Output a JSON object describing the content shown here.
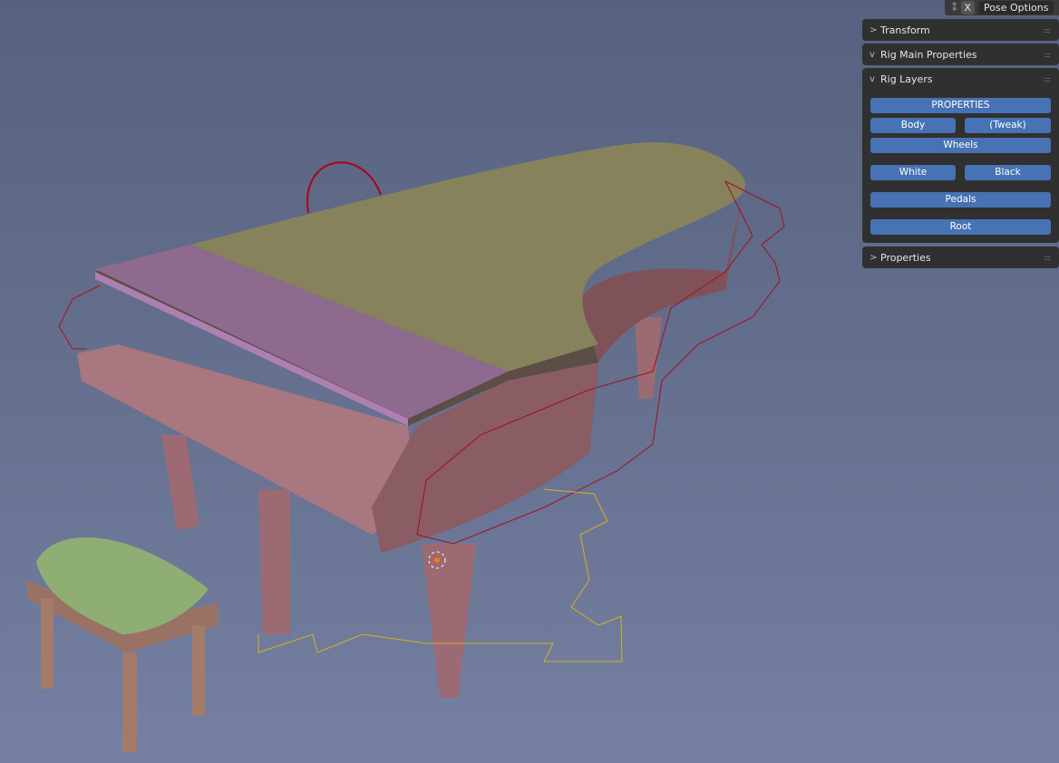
{
  "header": {
    "xray_icon": "xray-icon",
    "x_label": "X",
    "pose_options": "Pose Options"
  },
  "panels": [
    {
      "title": "Transform",
      "expanded": false
    },
    {
      "title": "Rig Main Properties",
      "expanded": true
    },
    {
      "title": "Rig Layers",
      "expanded": true
    },
    {
      "title": "Properties",
      "expanded": false
    }
  ],
  "rig_layers": {
    "properties": "PROPERTIES",
    "body": "Body",
    "tweak": "(Tweak)",
    "wheels": "Wheels",
    "white": "White",
    "black": "Black",
    "pedals": "Pedals",
    "root": "Root"
  },
  "colors": {
    "button": "#4772b3",
    "panel": "#303030"
  }
}
